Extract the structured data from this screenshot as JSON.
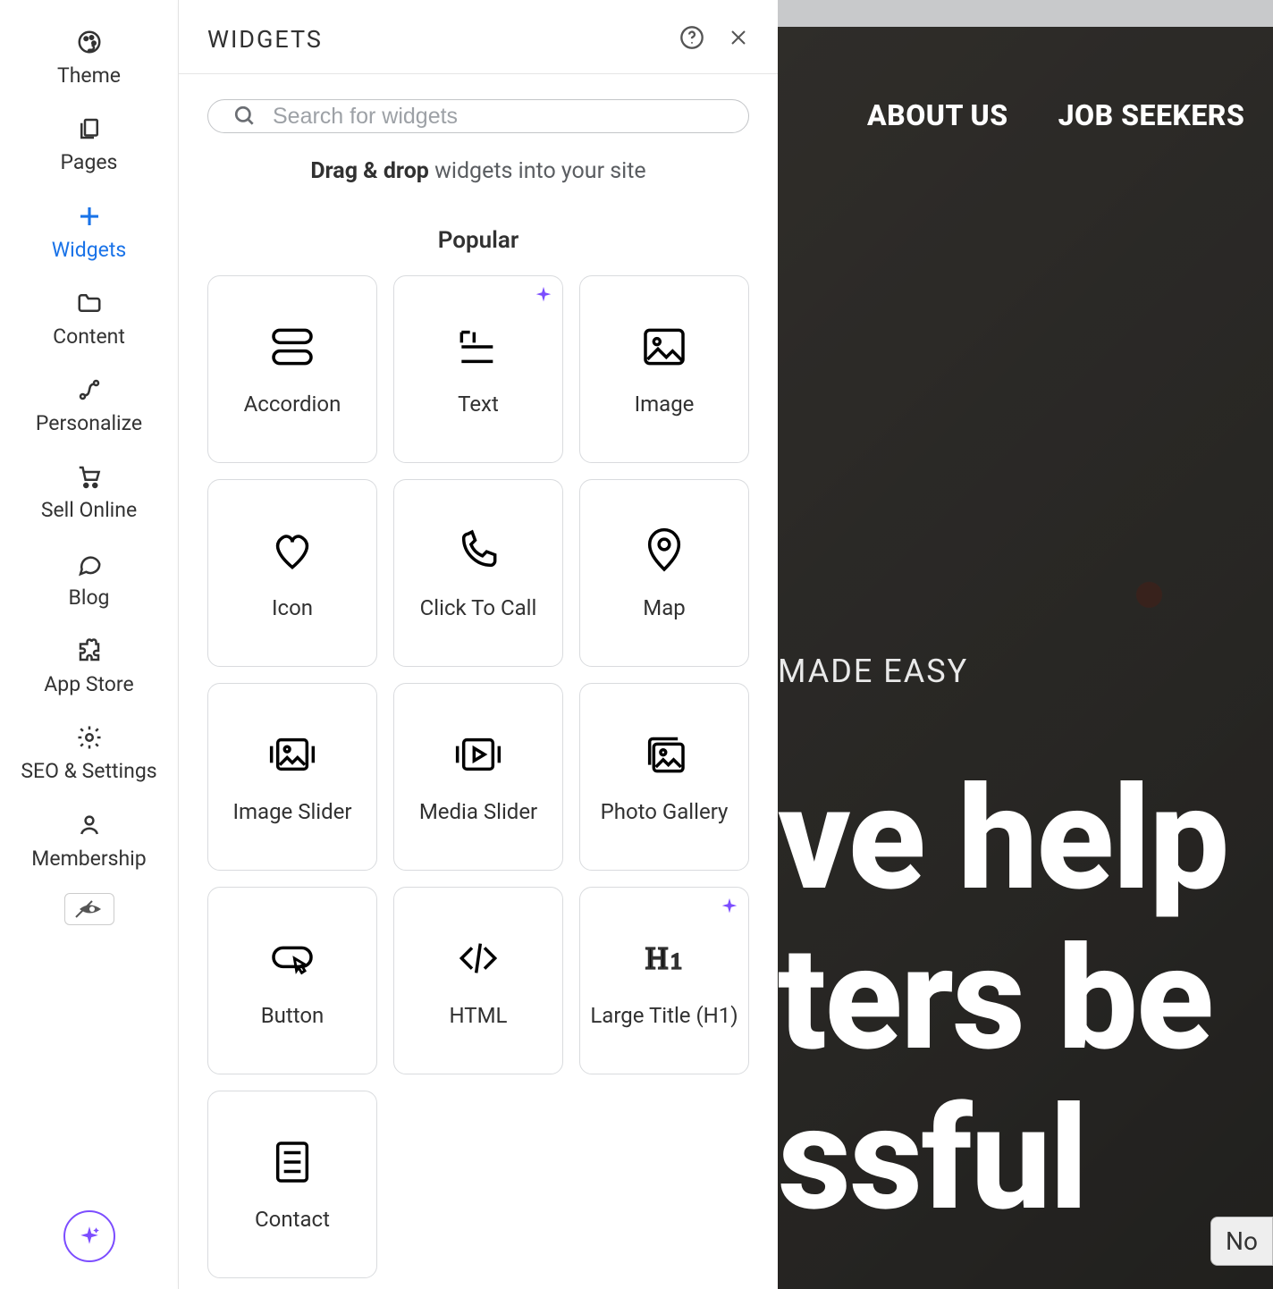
{
  "sidebar": {
    "items": [
      {
        "label": "Theme",
        "icon": "palette-icon",
        "active": false
      },
      {
        "label": "Pages",
        "icon": "pages-icon",
        "active": false
      },
      {
        "label": "Widgets",
        "icon": "plus-icon",
        "active": true
      },
      {
        "label": "Content",
        "icon": "folder-icon",
        "active": false
      },
      {
        "label": "Personalize",
        "icon": "route-icon",
        "active": false
      },
      {
        "label": "Sell Online",
        "icon": "cart-icon",
        "active": false
      },
      {
        "label": "Blog",
        "icon": "chat-icon",
        "active": false
      },
      {
        "label": "App Store",
        "icon": "puzzle-icon",
        "active": false
      },
      {
        "label": "SEO & Settings",
        "icon": "gear-icon",
        "active": false
      },
      {
        "label": "Membership",
        "icon": "person-icon",
        "active": false
      }
    ]
  },
  "panel": {
    "title": "WIDGETS",
    "search_placeholder": "Search for widgets",
    "helper_bold": "Drag & drop",
    "helper_rest": " widgets into your site",
    "section": "Popular",
    "widgets": [
      {
        "label": "Accordion",
        "icon": "accordion",
        "spark": false
      },
      {
        "label": "Text",
        "icon": "text",
        "spark": true
      },
      {
        "label": "Image",
        "icon": "image",
        "spark": false
      },
      {
        "label": "Icon",
        "icon": "heart",
        "spark": false
      },
      {
        "label": "Click To Call",
        "icon": "phone",
        "spark": false
      },
      {
        "label": "Map",
        "icon": "mappin",
        "spark": false
      },
      {
        "label": "Image Slider",
        "icon": "imageslider",
        "spark": false
      },
      {
        "label": "Media Slider",
        "icon": "mediaslider",
        "spark": false
      },
      {
        "label": "Photo Gallery",
        "icon": "gallery",
        "spark": false
      },
      {
        "label": "Button",
        "icon": "button",
        "spark": false
      },
      {
        "label": "HTML",
        "icon": "html",
        "spark": false
      },
      {
        "label": "Large Title (H1)",
        "icon": "h1",
        "spark": true
      },
      {
        "label": "Contact",
        "icon": "contact",
        "spark": false
      }
    ]
  },
  "canvas": {
    "nav": [
      "ABOUT US",
      "JOB SEEKERS"
    ],
    "tagline_fragment": "MADE EASY",
    "hero_lines": [
      "ve help",
      "ters be ",
      "ssful"
    ],
    "bottom_chip": "No"
  }
}
